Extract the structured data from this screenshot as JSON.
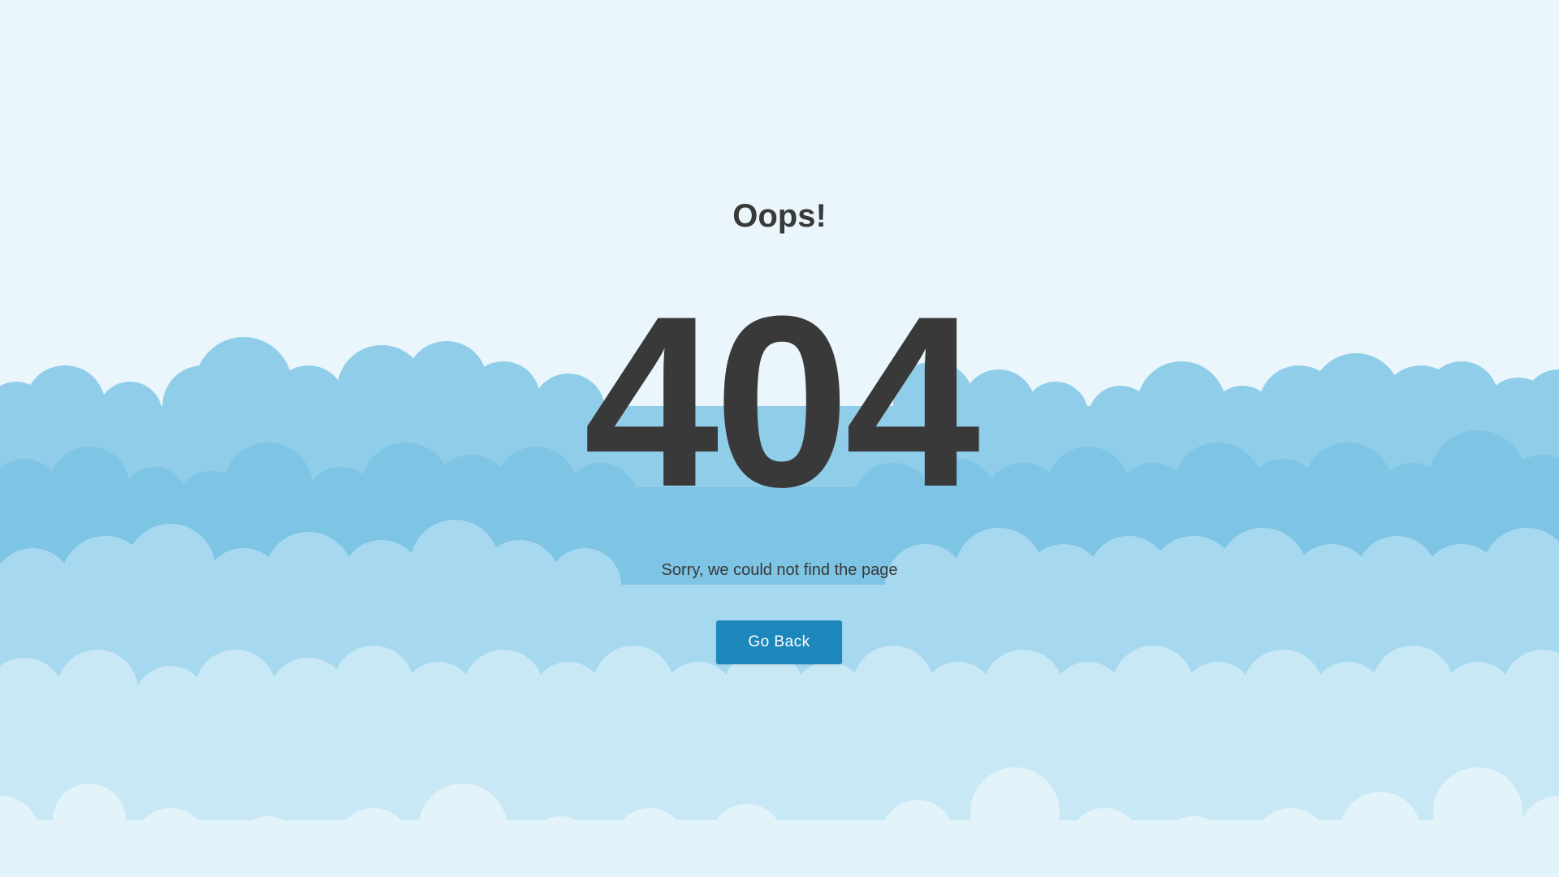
{
  "page": {
    "title": "Oops!",
    "error_code": "404",
    "message": "Sorry, we could not find the page",
    "back_button_label": "Go Back"
  },
  "colors": {
    "background_sky": "#eaf6fb",
    "text": "#393939",
    "button": "#1c87bb",
    "button_text": "#ffffff",
    "cloud_dark": "#7ec4e4",
    "cloud_mid": "#a6d8ef",
    "cloud_light": "#c8e8f5",
    "cloud_pale": "#e2f3fa"
  }
}
